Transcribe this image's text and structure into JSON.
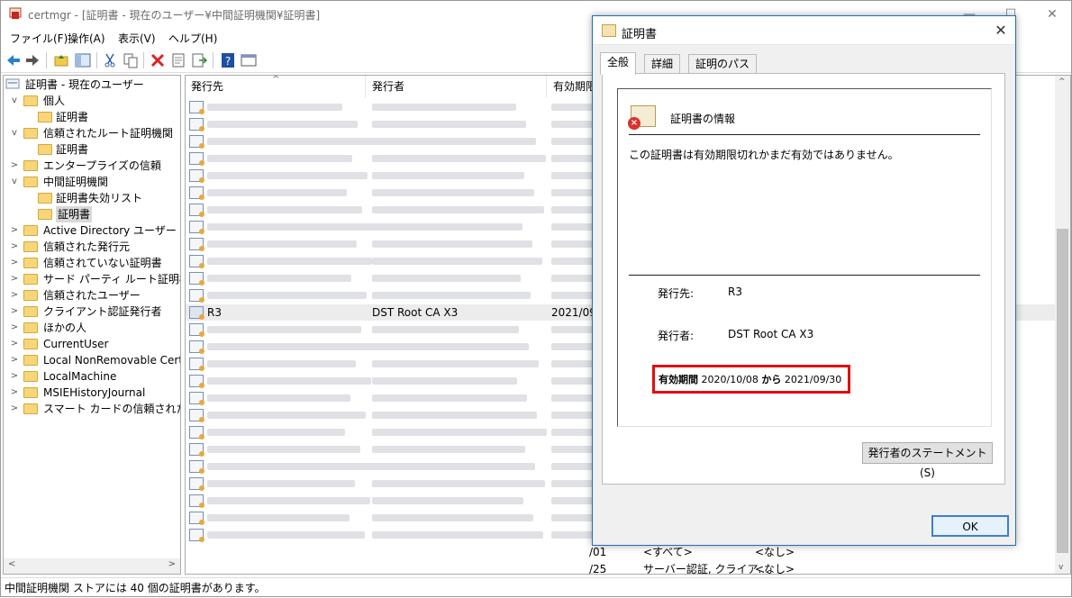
{
  "window": {
    "title": "certmgr - [証明書 - 現在のユーザー¥中間証明機関¥証明書]"
  },
  "menu": [
    "ファイル(F)",
    "操作(A)",
    "表示(V)",
    "ヘルプ(H)"
  ],
  "tree": {
    "root": "証明書 - 現在のユーザー",
    "nodes": [
      {
        "label": "個人",
        "level": 1,
        "expanded": true
      },
      {
        "label": "証明書",
        "level": 2
      },
      {
        "label": "信頼されたルート証明機関",
        "level": 1,
        "expanded": true
      },
      {
        "label": "証明書",
        "level": 2
      },
      {
        "label": "エンタープライズの信頼",
        "level": 1
      },
      {
        "label": "中間証明機関",
        "level": 1,
        "expanded": true
      },
      {
        "label": "証明書失効リスト",
        "level": 2
      },
      {
        "label": "証明書",
        "level": 2,
        "selected": true
      },
      {
        "label": "Active Directory ユーザー オブジ",
        "level": 1
      },
      {
        "label": "信頼された発行元",
        "level": 1
      },
      {
        "label": "信頼されていない証明書",
        "level": 1
      },
      {
        "label": "サード パーティ ルート証明機関",
        "level": 1
      },
      {
        "label": "信頼されたユーザー",
        "level": 1
      },
      {
        "label": "クライアント認証発行者",
        "level": 1
      },
      {
        "label": "ほかの人",
        "level": 1
      },
      {
        "label": "CurrentUser",
        "level": 1
      },
      {
        "label": "Local NonRemovable Certific",
        "level": 1
      },
      {
        "label": "LocalMachine",
        "level": 1
      },
      {
        "label": "MSIEHistoryJournal",
        "level": 1
      },
      {
        "label": "スマート カードの信頼されたルート",
        "level": 1
      }
    ]
  },
  "list": {
    "columns": [
      "発行先",
      "発行者",
      "有効期限"
    ],
    "selected_row": {
      "issued_to": "R3",
      "issued_by": "DST Root CA X3",
      "expiry": "2021/09/"
    },
    "bottom_rows": [
      {
        "expiry": "/01",
        "purpose": "<すべて>",
        "name": "<なし>"
      },
      {
        "expiry": "/25",
        "purpose": "サーバー認証, クライア...",
        "name": "<なし>"
      }
    ]
  },
  "status": "中間証明機関 ストアには 40 個の証明書があります。",
  "dialog": {
    "title": "証明書",
    "tabs": [
      "全般",
      "詳細",
      "証明のパス"
    ],
    "info_title": "証明書の情報",
    "message": "この証明書は有効期限切れかまだ有効ではありません。",
    "issued_to_label": "発行先:",
    "issued_to": "R3",
    "issued_by_label": "発行者:",
    "issued_by": "DST Root CA X3",
    "validity_label": "有効期間",
    "valid_from": "2020/10/08",
    "valid_sep": "から",
    "valid_to": "2021/09/30",
    "issuer_statement_button": "発行者のステートメント(S)",
    "ok_button": "OK",
    "close_glyph": "✕"
  },
  "window_controls": {
    "minimize": "—",
    "maximize": "☐",
    "close": "✕"
  }
}
